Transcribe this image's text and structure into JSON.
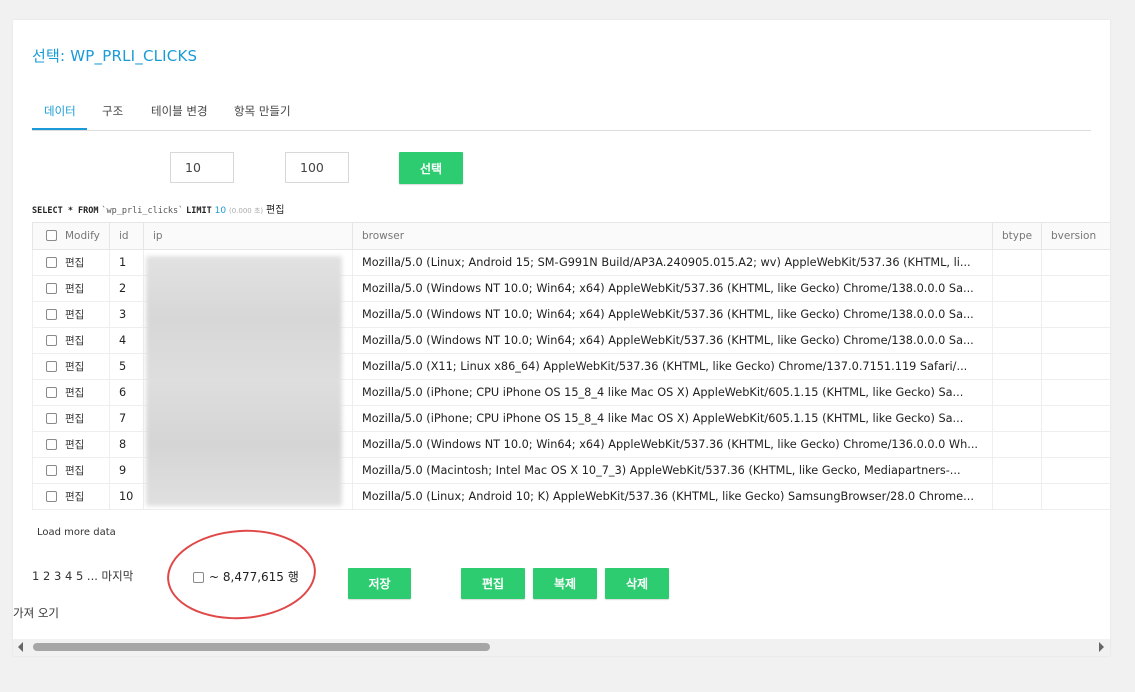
{
  "header": {
    "title": "선택: WP_PRLI_CLICKS"
  },
  "tabs": [
    {
      "label": "데이터",
      "active": true
    },
    {
      "label": "구조"
    },
    {
      "label": "테이블 변경"
    },
    {
      "label": "항목 만들기"
    }
  ],
  "query_controls": {
    "offset_value": "10",
    "limit_value": "100",
    "select_label": "선택"
  },
  "sql": {
    "select_kw": "SELECT * FROM",
    "table": "`wp_prli_clicks`",
    "limit_kw": "LIMIT",
    "limit_num": "10",
    "time": "(0.000 초)",
    "edit_label": "편집"
  },
  "table": {
    "columns": [
      "Modify",
      "id",
      "ip",
      "browser",
      "btype",
      "bversion"
    ],
    "edit_label": "편집",
    "rows": [
      {
        "id": "1",
        "browser": "Mozilla/5.0 (Linux; Android 15; SM-G991N Build/AP3A.240905.015.A2; wv) AppleWebKit/537.36 (KHTML, li..."
      },
      {
        "id": "2",
        "browser": "Mozilla/5.0 (Windows NT 10.0; Win64; x64) AppleWebKit/537.36 (KHTML, like Gecko) Chrome/138.0.0.0 Sa..."
      },
      {
        "id": "3",
        "browser": "Mozilla/5.0 (Windows NT 10.0; Win64; x64) AppleWebKit/537.36 (KHTML, like Gecko) Chrome/138.0.0.0 Sa..."
      },
      {
        "id": "4",
        "browser": "Mozilla/5.0 (Windows NT 10.0; Win64; x64) AppleWebKit/537.36 (KHTML, like Gecko) Chrome/138.0.0.0 Sa..."
      },
      {
        "id": "5",
        "browser": "Mozilla/5.0 (X11; Linux x86_64) AppleWebKit/537.36 (KHTML, like Gecko) Chrome/137.0.7151.119 Safari/..."
      },
      {
        "id": "6",
        "browser": "Mozilla/5.0 (iPhone; CPU iPhone OS 15_8_4 like Mac OS X) AppleWebKit/605.1.15 (KHTML, like Gecko) Sa..."
      },
      {
        "id": "7",
        "browser": "Mozilla/5.0 (iPhone; CPU iPhone OS 15_8_4 like Mac OS X) AppleWebKit/605.1.15 (KHTML, like Gecko) Sa..."
      },
      {
        "id": "8",
        "browser": "Mozilla/5.0 (Windows NT 10.0; Win64; x64) AppleWebKit/537.36 (KHTML, like Gecko) Chrome/136.0.0.0 Wh..."
      },
      {
        "id": "9",
        "browser": "Mozilla/5.0 (Macintosh; Intel Mac OS X 10_7_3) AppleWebKit/537.36 (KHTML, like Gecko, Mediapartners-..."
      },
      {
        "id": "10",
        "browser": "Mozilla/5.0 (Linux; Android 10; K) AppleWebKit/537.36 (KHTML, like Gecko) SamsungBrowser/28.0 Chrome..."
      }
    ]
  },
  "footer": {
    "load_more": "Load more data",
    "pages": [
      "1",
      "2",
      "3",
      "4",
      "5"
    ],
    "ellipsis": "...",
    "last_page": "마지막",
    "row_count": "~ 8,477,615 행",
    "save_label": "저장",
    "edit_label": "편집",
    "clone_label": "복제",
    "delete_label": "삭제",
    "import_label": "가져 오기"
  },
  "colors": {
    "accent": "#1a9bd7",
    "button_green": "#2ecc71",
    "annotation_red": "#e04848"
  }
}
